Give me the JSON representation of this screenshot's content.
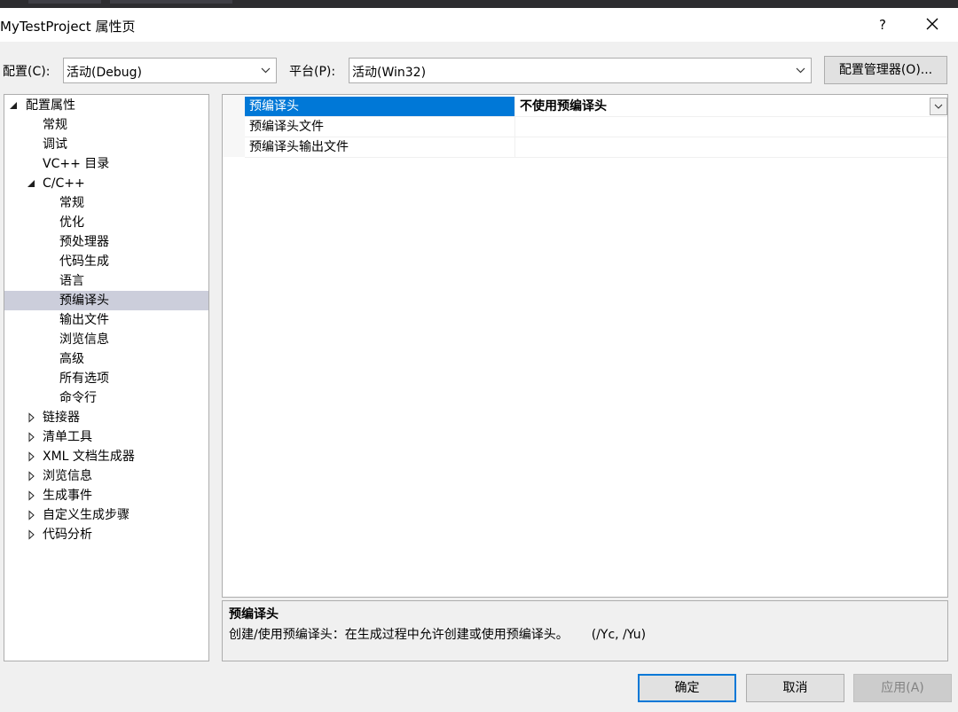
{
  "window": {
    "title": "MyTestProject 属性页",
    "help_label": "?"
  },
  "config_row": {
    "config_label": "配置(C):",
    "config_value": "活动(Debug)",
    "platform_label": "平台(P):",
    "platform_value": "活动(Win32)",
    "manager_button": "配置管理器(O)..."
  },
  "tree": {
    "items": [
      {
        "label": "配置属性",
        "level": 0,
        "state": "expanded"
      },
      {
        "label": "常规",
        "level": 1,
        "state": "leaf"
      },
      {
        "label": "调试",
        "level": 1,
        "state": "leaf"
      },
      {
        "label": "VC++ 目录",
        "level": 1,
        "state": "leaf"
      },
      {
        "label": "C/C++",
        "level": 1,
        "state": "expanded"
      },
      {
        "label": "常规",
        "level": 2,
        "state": "leaf"
      },
      {
        "label": "优化",
        "level": 2,
        "state": "leaf"
      },
      {
        "label": "预处理器",
        "level": 2,
        "state": "leaf"
      },
      {
        "label": "代码生成",
        "level": 2,
        "state": "leaf"
      },
      {
        "label": "语言",
        "level": 2,
        "state": "leaf"
      },
      {
        "label": "预编译头",
        "level": 2,
        "state": "leaf",
        "selected": true
      },
      {
        "label": "输出文件",
        "level": 2,
        "state": "leaf"
      },
      {
        "label": "浏览信息",
        "level": 2,
        "state": "leaf"
      },
      {
        "label": "高级",
        "level": 2,
        "state": "leaf"
      },
      {
        "label": "所有选项",
        "level": 2,
        "state": "leaf"
      },
      {
        "label": "命令行",
        "level": 2,
        "state": "leaf"
      },
      {
        "label": "链接器",
        "level": 1,
        "state": "collapsed"
      },
      {
        "label": "清单工具",
        "level": 1,
        "state": "collapsed"
      },
      {
        "label": "XML 文档生成器",
        "level": 1,
        "state": "collapsed"
      },
      {
        "label": "浏览信息",
        "level": 1,
        "state": "collapsed"
      },
      {
        "label": "生成事件",
        "level": 1,
        "state": "collapsed"
      },
      {
        "label": "自定义生成步骤",
        "level": 1,
        "state": "collapsed"
      },
      {
        "label": "代码分析",
        "level": 1,
        "state": "collapsed"
      }
    ]
  },
  "properties": {
    "rows": [
      {
        "name": "预编译头",
        "value": "不使用预编译头",
        "selected": true
      },
      {
        "name": "预编译头文件",
        "value": ""
      },
      {
        "name": "预编译头输出文件",
        "value": ""
      }
    ]
  },
  "description": {
    "title": "预编译头",
    "text": "创建/使用预编译头：在生成过程中允许创建或使用预编译头。",
    "flags": "(/Yc, /Yu)"
  },
  "buttons": {
    "ok": "确定",
    "cancel": "取消",
    "apply": "应用(A)"
  },
  "colors": {
    "selection": "#0078d7",
    "tree_selection": "#cccedb",
    "dialog_bg": "#f0f0f0"
  }
}
